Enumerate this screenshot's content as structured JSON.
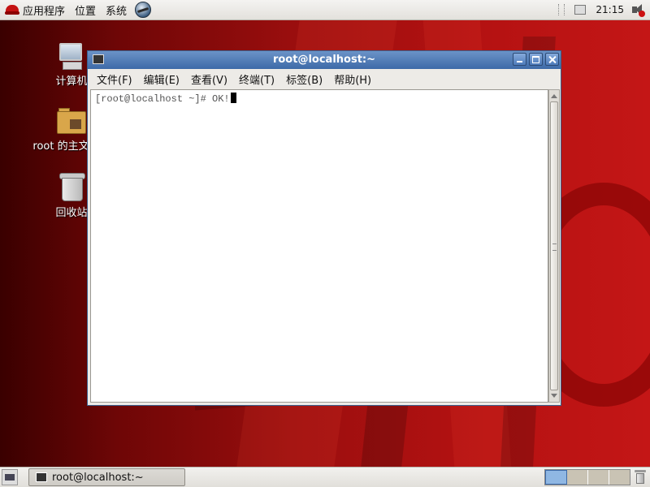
{
  "top_panel": {
    "menus": [
      {
        "label": "应用程序",
        "icon": "redhat-icon"
      },
      {
        "label": "位置"
      },
      {
        "label": "系统"
      }
    ],
    "launcher_icon": "globe-browser-icon",
    "clock": "21:15",
    "tray_icons": [
      "notification-area-icon",
      "volume-muted-icon"
    ]
  },
  "desktop": {
    "icons": [
      {
        "label": "计算机",
        "icon": "computer-icon"
      },
      {
        "label": "root 的主文件夹",
        "icon": "home-folder-icon"
      },
      {
        "label": "回收站",
        "icon": "trash-icon"
      }
    ]
  },
  "terminal": {
    "title": "root@localhost:~",
    "menu": [
      "文件(F)",
      "编辑(E)",
      "查看(V)",
      "终端(T)",
      "标签(B)",
      "帮助(H)"
    ],
    "line": "[root@localhost ~]# OK!"
  },
  "bottom_panel": {
    "task_label": "root@localhost:~",
    "workspaces": 4,
    "active_workspace": 1
  },
  "colors": {
    "titlebar": "#3d6aa8",
    "desktop_red": "#b51212"
  }
}
